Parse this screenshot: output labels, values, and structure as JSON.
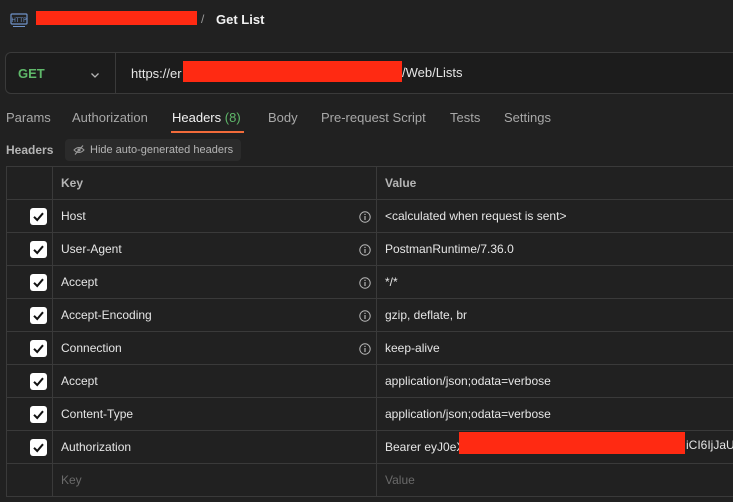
{
  "breadcrumb": {
    "icon": "http-icon",
    "separator": "/",
    "title": "Get List"
  },
  "request": {
    "method": "GET",
    "url_prefix": "https://er",
    "url_suffix": "/Web/Lists"
  },
  "tabs": [
    {
      "label": "Params"
    },
    {
      "label": "Authorization"
    },
    {
      "label": "Headers",
      "count": "(8)",
      "active": true
    },
    {
      "label": "Body"
    },
    {
      "label": "Pre-request Script"
    },
    {
      "label": "Tests"
    },
    {
      "label": "Settings"
    }
  ],
  "headers_section": {
    "label": "Headers",
    "hide_button_label": "Hide auto-generated headers"
  },
  "table": {
    "columns": {
      "key": "Key",
      "value": "Value"
    },
    "rows": [
      {
        "key": "Host",
        "value": "<calculated when request is sent>",
        "checked": true,
        "info": true
      },
      {
        "key": "User-Agent",
        "value": "PostmanRuntime/7.36.0",
        "checked": true,
        "info": true
      },
      {
        "key": "Accept",
        "value": "*/*",
        "checked": true,
        "info": true
      },
      {
        "key": "Accept-Encoding",
        "value": "gzip, deflate, br",
        "checked": true,
        "info": true
      },
      {
        "key": "Connection",
        "value": "keep-alive",
        "checked": true,
        "info": true
      },
      {
        "key": "Accept",
        "value": "application/json;odata=verbose",
        "checked": true,
        "info": false
      },
      {
        "key": "Content-Type",
        "value": "application/json;odata=verbose",
        "checked": true,
        "info": false
      },
      {
        "key": "Authorization",
        "value": "Bearer eyJ0eX",
        "value_suffix": "iCI6IjJaU",
        "checked": true,
        "info": false
      }
    ],
    "placeholder": {
      "key": "Key",
      "value": "Value"
    }
  },
  "colors": {
    "accent": "#f26b3a",
    "method": "#5fb86a",
    "redaction": "#ff2a12"
  }
}
